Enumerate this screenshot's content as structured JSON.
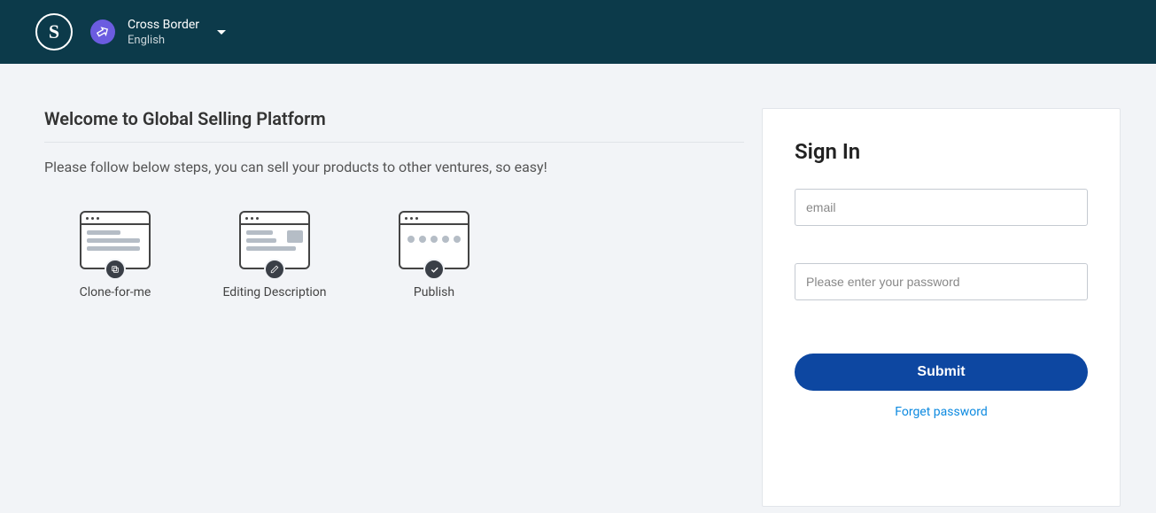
{
  "header": {
    "title": "Cross Border",
    "language": "English"
  },
  "main": {
    "welcome_title": "Welcome to Global Selling Platform",
    "subtitle": "Please follow below steps, you can sell your products to other ventures, so easy!",
    "steps": [
      {
        "label": "Clone-for-me"
      },
      {
        "label": "Editing Description"
      },
      {
        "label": "Publish"
      }
    ]
  },
  "signin": {
    "title": "Sign In",
    "email_placeholder": "email",
    "password_placeholder": "Please enter your password",
    "submit_label": "Submit",
    "forget_label": "Forget password"
  }
}
